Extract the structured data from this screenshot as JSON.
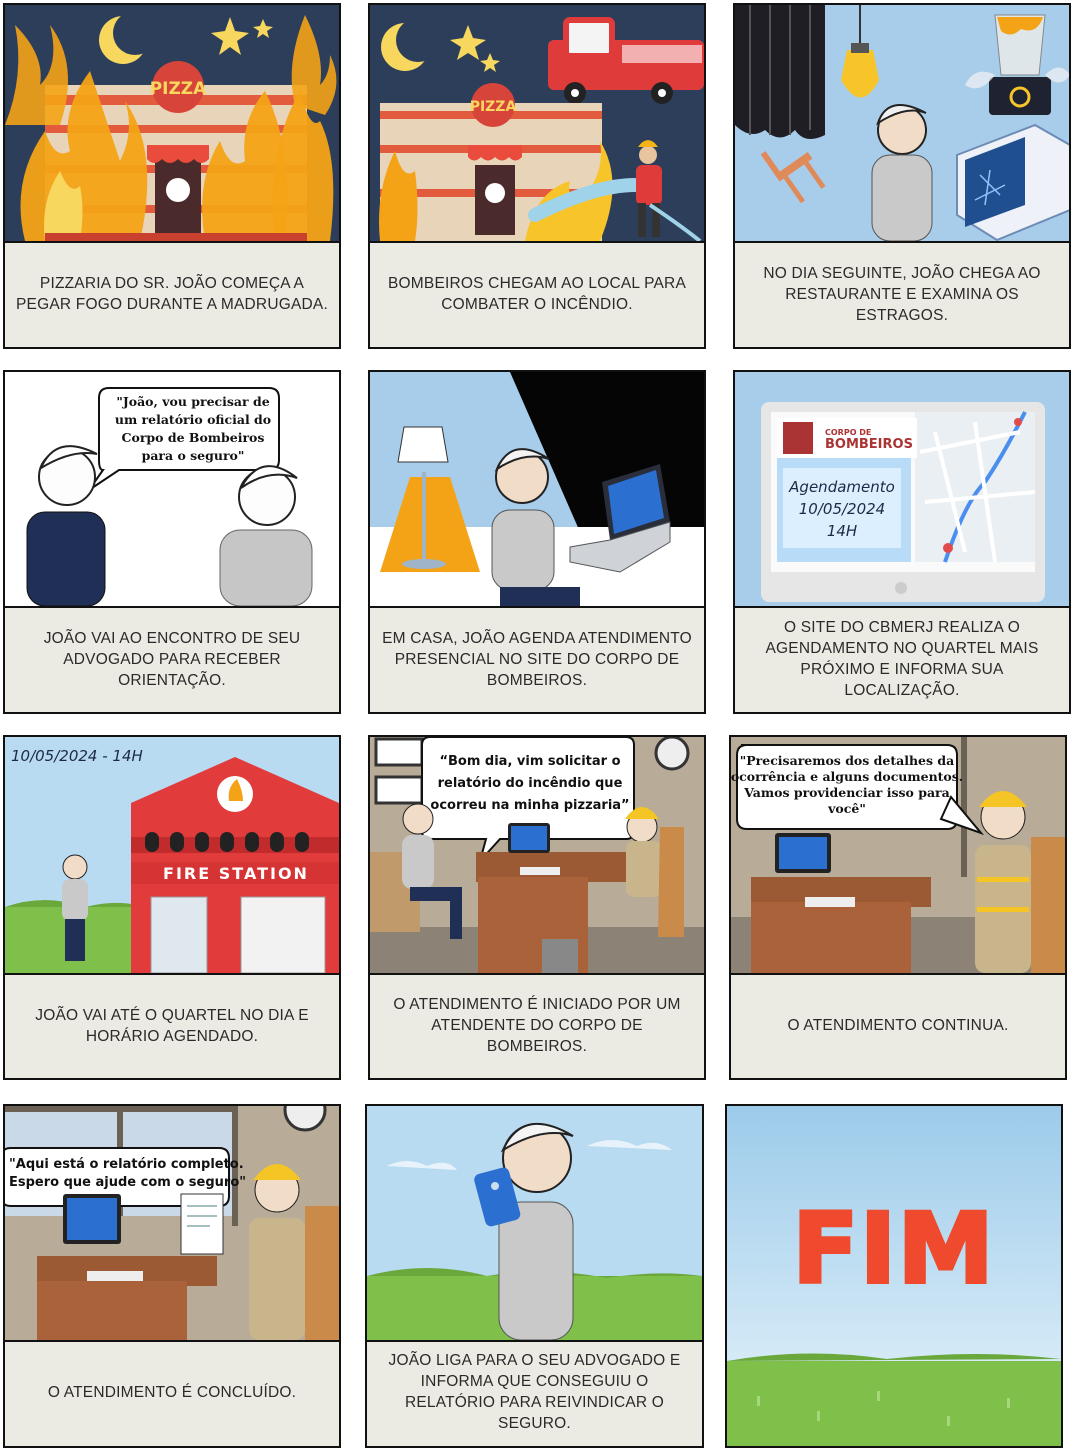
{
  "panels": [
    {
      "caption": "PIZZARIA DO SR. JOÃO COMEÇA A PEGAR FOGO DURANTE A MADRUGADA.",
      "sign": "PIZZA"
    },
    {
      "caption": "BOMBEIROS CHEGAM AO LOCAL PARA COMBATER O INCÊNDIO.",
      "sign": "PIZZA"
    },
    {
      "caption": "NO DIA SEGUINTE, JOÃO CHEGA AO RESTAURANTE E EXAMINA OS ESTRAGOS."
    },
    {
      "caption": "JOÃO VAI AO ENCONTRO DE SEU ADVOGADO PARA RECEBER ORIENTAÇÃO.",
      "speech": [
        "\"João, vou precisar de",
        "um relatório oficial do",
        "Corpo de Bombeiros",
        "para o seguro\""
      ]
    },
    {
      "caption": "EM CASA, JOÃO AGENDA ATENDIMENTO PRESENCIAL NO SITE DO CORPO DE BOMBEIROS."
    },
    {
      "caption": "O SITE DO CBMERJ REALIZA O AGENDAMENTO NO QUARTEL MAIS PRÓXIMO E INFORMA SUA LOCALIZAÇÃO.",
      "site_brand_small": "CORPO DE",
      "site_brand": "BOMBEIROS",
      "appointment": [
        "Agendamento",
        "10/05/2024",
        "14H"
      ]
    },
    {
      "caption": "JOÃO VAI ATÉ O QUARTEL NO DIA E HORÁRIO AGENDADO.",
      "date_label": "10/05/2024 - 14H",
      "station_sign": "FIRE STATION"
    },
    {
      "caption": "O ATENDIMENTO É INICIADO POR UM ATENDENTE DO CORPO DE BOMBEIROS.",
      "speech": [
        "“Bom dia, vim solicitar o",
        "relatório do incêndio que",
        "ocorreu na minha pizzaria”"
      ]
    },
    {
      "caption": "O ATENDIMENTO CONTINUA.",
      "speech": [
        "\"Precisaremos dos detalhes da",
        "ocorrência e alguns documentos.",
        "Vamos providenciar isso para",
        "você\""
      ]
    },
    {
      "caption": "O ATENDIMENTO É CONCLUÍDO.",
      "speech": [
        "\"Aqui está o relatório completo.",
        "Espero que ajude com o seguro\""
      ]
    },
    {
      "caption": "JOÃO LIGA PARA O SEU ADVOGADO E INFORMA QUE CONSEGUIU O RELATÓRIO PARA REIVINDICAR O SEGURO."
    },
    {
      "caption": "",
      "big_text": "FIM"
    }
  ],
  "colors": {
    "night": "#2c3e5a",
    "fire": "#f4a316",
    "brick": "#e25b3c",
    "sky": "#a8cdea",
    "grass": "#7fc04a",
    "fim": "#ef4a2e",
    "caption_bg": "#ecebe3"
  }
}
